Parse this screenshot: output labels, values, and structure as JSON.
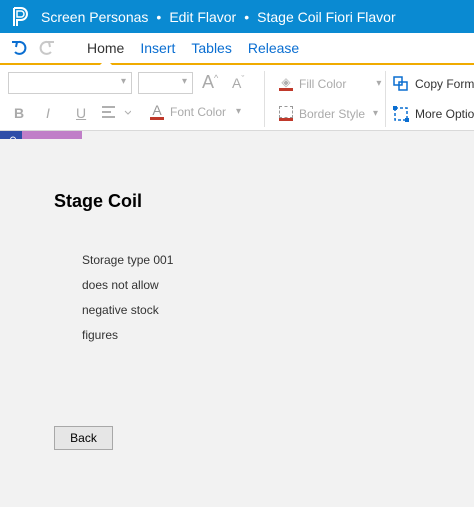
{
  "titlebar": {
    "app": "Screen Personas",
    "crumbs": [
      "Edit Flavor",
      "Stage Coil Fiori Flavor"
    ],
    "separator": "•",
    "icon": "personas-logo-icon"
  },
  "tabs": [
    {
      "label": "Home",
      "active": true
    },
    {
      "label": "Insert"
    },
    {
      "label": "Tables"
    },
    {
      "label": "Release"
    }
  ],
  "ribbon": {
    "grow_font": "A",
    "shrink_font": "A",
    "bold": "B",
    "italic": "I",
    "underline": "U",
    "font_color": "Font Color",
    "fill_color": "Fill Color",
    "border_style": "Border Style",
    "copy_format": "Copy Format",
    "more_options": "More Options"
  },
  "screen": {
    "heading": "Stage Coil",
    "message_lines": [
      "Storage type 001",
      "does not allow",
      "negative stock",
      "figures"
    ],
    "back_button": "Back"
  },
  "colors": {
    "titlebar": "#0a8ad2",
    "tab_link": "#0a6ed1",
    "accent_line": "#f0ab00",
    "font_color_swatch": "#c0392b"
  }
}
